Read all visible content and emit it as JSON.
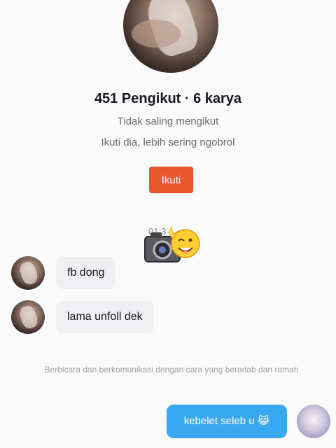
{
  "profile": {
    "stats": "451 Pengikut · 6 karya",
    "mutual_status": "Tidak saling mengikut",
    "follow_hint": "Ikuti dia, lebih sering ngobrol",
    "follow_button": "Ikuti"
  },
  "chat": {
    "timestamp": "01:3",
    "messages": [
      {
        "from": "other",
        "text": "fb dong"
      },
      {
        "from": "other",
        "text": "lama unfoll dek"
      }
    ],
    "notice": "Berbicara dan berkomunikasi dengan cara yang beradab dan ramah",
    "my_message": "kebelet seleb u 😹"
  },
  "colors": {
    "follow_button": "#e9572f",
    "my_bubble": "#3aa8f0",
    "other_bubble": "#f0f0f2"
  },
  "icons": {
    "sticker": "camera-flash-wink-sticker"
  }
}
